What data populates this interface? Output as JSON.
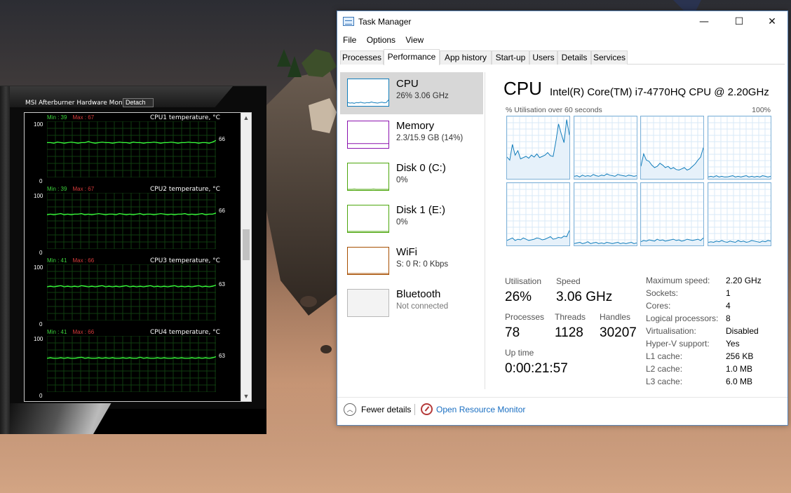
{
  "colors": {
    "cpu": "#117dbb",
    "memory": "#8b12ae",
    "disk": "#4da60c",
    "wifi": "#a74f01",
    "graph_green": "#39ff3c",
    "min_green": "#3bd13b",
    "max_red": "#d63a3a"
  },
  "afterburner": {
    "title": "MSI Afterburner Hardware Monitor",
    "detach": "Detach",
    "graphs": [
      {
        "name": "CPU1 temperature, °C",
        "min_label": "Min : 39",
        "max_label": "Max : 67",
        "y_top": "100",
        "y_bottom": "0",
        "current": "66",
        "current_value": 66,
        "values": [
          62,
          62,
          61,
          63,
          62,
          61,
          62,
          63,
          62,
          61,
          62,
          62,
          64,
          62,
          61,
          62,
          63,
          62,
          62,
          61,
          62,
          63,
          62,
          62,
          61,
          63,
          62,
          62,
          61,
          62,
          62,
          63,
          62,
          61,
          62,
          62,
          63,
          62,
          61,
          62,
          62,
          63,
          62,
          62,
          61,
          62,
          62,
          61,
          63,
          66
        ]
      },
      {
        "name": "CPU2 temperature, °C",
        "min_label": "Min : 39",
        "max_label": "Max : 67",
        "y_top": "100",
        "y_bottom": "0",
        "current": "66",
        "current_value": 66,
        "values": [
          61,
          62,
          61,
          62,
          63,
          61,
          62,
          61,
          62,
          62,
          63,
          61,
          62,
          61,
          62,
          63,
          62,
          61,
          62,
          62,
          61,
          63,
          62,
          61,
          62,
          61,
          62,
          63,
          61,
          62,
          62,
          61,
          62,
          63,
          62,
          61,
          62,
          61,
          62,
          62,
          63,
          61,
          62,
          61,
          62,
          63,
          61,
          62,
          62,
          64
        ]
      },
      {
        "name": "CPU3 temperature, °C",
        "min_label": "Min : 41",
        "max_label": "Max : 66",
        "y_top": "100",
        "y_bottom": "0",
        "current": "63",
        "current_value": 63,
        "values": [
          60,
          61,
          60,
          61,
          62,
          60,
          61,
          60,
          61,
          60,
          62,
          61,
          60,
          61,
          60,
          61,
          62,
          60,
          61,
          60,
          61,
          60,
          61,
          62,
          60,
          61,
          60,
          61,
          60,
          61,
          62,
          60,
          61,
          60,
          61,
          60,
          61,
          62,
          60,
          61,
          60,
          61,
          60,
          61,
          62,
          60,
          61,
          60,
          61,
          63
        ]
      },
      {
        "name": "CPU4 temperature, °C",
        "min_label": "Min : 41",
        "max_label": "Max : 66",
        "y_top": "100",
        "y_bottom": "0",
        "current": "63",
        "current_value": 63,
        "values": [
          60,
          61,
          60,
          60,
          61,
          60,
          61,
          60,
          60,
          61,
          62,
          60,
          61,
          60,
          60,
          61,
          60,
          61,
          60,
          61,
          60,
          60,
          61,
          60,
          61,
          60,
          60,
          62,
          60,
          61,
          60,
          60,
          61,
          60,
          61,
          60,
          60,
          61,
          60,
          61,
          60,
          60,
          61,
          60,
          61,
          60,
          61,
          60,
          61,
          63
        ]
      }
    ]
  },
  "task_manager": {
    "title": "Task Manager",
    "window_buttons": {
      "minimize": "—",
      "maximize": "☐",
      "close": "✕"
    },
    "menu": [
      "File",
      "Options",
      "View"
    ],
    "tabs": [
      "Processes",
      "Performance",
      "App history",
      "Start-up",
      "Users",
      "Details",
      "Services"
    ],
    "active_tab": "Performance",
    "sidebar": [
      {
        "name": "CPU",
        "sub": "26%  3.06 GHz",
        "color": "#117dbb",
        "selected": true,
        "spark": [
          10,
          8,
          9,
          7,
          10,
          9,
          11,
          9,
          8,
          10,
          9,
          12,
          10,
          9,
          8,
          10,
          11,
          9,
          10,
          20
        ]
      },
      {
        "name": "Memory",
        "sub": "2.3/15.9 GB (14%)",
        "color": "#8b12ae",
        "selected": false,
        "spark": [
          14,
          14,
          14,
          14,
          14,
          14,
          14,
          14,
          14,
          14,
          14,
          14,
          14,
          14,
          14,
          14,
          14,
          14,
          14,
          14
        ]
      },
      {
        "name": "Disk 0 (C:)",
        "sub": "0%",
        "color": "#4da60c",
        "selected": false,
        "spark": [
          0,
          0,
          0,
          1,
          0,
          0,
          0,
          0,
          0,
          0,
          0,
          0,
          1,
          0,
          0,
          0,
          0,
          0,
          0,
          0
        ]
      },
      {
        "name": "Disk 1 (E:)",
        "sub": "0%",
        "color": "#4da60c",
        "selected": false,
        "spark": [
          0,
          0,
          0,
          0,
          0,
          0,
          0,
          0,
          0,
          0,
          0,
          0,
          0,
          0,
          0,
          0,
          0,
          0,
          0,
          0
        ]
      },
      {
        "name": "WiFi",
        "sub": "S: 0 R: 0 Kbps",
        "color": "#a74f01",
        "selected": false,
        "spark": [
          0,
          0,
          0,
          0,
          0,
          0,
          0,
          0,
          0,
          0,
          0,
          0,
          0,
          0,
          0,
          0,
          0,
          0,
          0,
          0
        ]
      },
      {
        "name": "Bluetooth",
        "sub": "Not connected",
        "color": "#b8b8b8",
        "selected": false,
        "spark": []
      }
    ],
    "cpu": {
      "heading": "CPU",
      "model": "Intel(R) Core(TM) i7-4770HQ CPU @ 2.20GHz",
      "util_label": "% Utilisation over 60 seconds",
      "util_max": "100%",
      "cores": [
        {
          "values": [
            35,
            30,
            55,
            38,
            45,
            32,
            34,
            36,
            33,
            38,
            35,
            40,
            34,
            36,
            38,
            42,
            37,
            36,
            60,
            88,
            72,
            58,
            95,
            70
          ]
        },
        {
          "values": [
            4,
            5,
            3,
            6,
            4,
            5,
            4,
            7,
            5,
            4,
            6,
            5,
            8,
            6,
            5,
            4,
            7,
            6,
            5,
            4,
            6,
            5,
            4,
            5
          ]
        },
        {
          "values": [
            20,
            40,
            30,
            28,
            22,
            18,
            20,
            25,
            22,
            18,
            20,
            16,
            18,
            15,
            14,
            16,
            18,
            14,
            16,
            20,
            24,
            30,
            35,
            50
          ]
        },
        {
          "values": [
            3,
            4,
            3,
            5,
            3,
            4,
            3,
            3,
            4,
            5,
            3,
            4,
            3,
            4,
            5,
            3,
            4,
            3,
            4,
            3,
            5,
            4,
            3,
            4
          ]
        },
        {
          "values": [
            8,
            10,
            12,
            8,
            10,
            9,
            12,
            10,
            8,
            9,
            10,
            12,
            11,
            9,
            10,
            12,
            14,
            10,
            11,
            13,
            12,
            15,
            14,
            24
          ]
        },
        {
          "values": [
            3,
            4,
            5,
            3,
            4,
            6,
            3,
            4,
            5,
            3,
            4,
            3,
            5,
            4,
            3,
            4,
            5,
            3,
            4,
            3,
            4,
            5,
            3,
            4
          ]
        },
        {
          "values": [
            6,
            8,
            7,
            9,
            8,
            7,
            10,
            8,
            9,
            7,
            8,
            9,
            10,
            8,
            9,
            7,
            8,
            10,
            9,
            8,
            9,
            10,
            8,
            12
          ]
        },
        {
          "values": [
            5,
            6,
            5,
            7,
            6,
            8,
            6,
            5,
            7,
            6,
            5,
            8,
            6,
            7,
            5,
            6,
            8,
            7,
            6,
            5,
            7,
            6,
            8,
            7
          ]
        }
      ],
      "stats": {
        "utilisation_label": "Utilisation",
        "utilisation": "26%",
        "speed_label": "Speed",
        "speed": "3.06 GHz",
        "processes_label": "Processes",
        "processes": "78",
        "threads_label": "Threads",
        "threads": "1128",
        "handles_label": "Handles",
        "handles": "30207",
        "uptime_label": "Up time",
        "uptime": "0:00:21:57"
      },
      "details": [
        {
          "k": "Maximum speed:",
          "v": "2.20 GHz"
        },
        {
          "k": "Sockets:",
          "v": "1"
        },
        {
          "k": "Cores:",
          "v": "4"
        },
        {
          "k": "Logical processors:",
          "v": "8"
        },
        {
          "k": "Virtualisation:",
          "v": "Disabled"
        },
        {
          "k": "Hyper-V support:",
          "v": "Yes"
        },
        {
          "k": "L1 cache:",
          "v": "256 KB"
        },
        {
          "k": "L2 cache:",
          "v": "1.0 MB"
        },
        {
          "k": "L3 cache:",
          "v": "6.0 MB"
        }
      ]
    },
    "footer": {
      "fewer_details": "Fewer details",
      "resource_monitor": "Open Resource Monitor"
    }
  }
}
